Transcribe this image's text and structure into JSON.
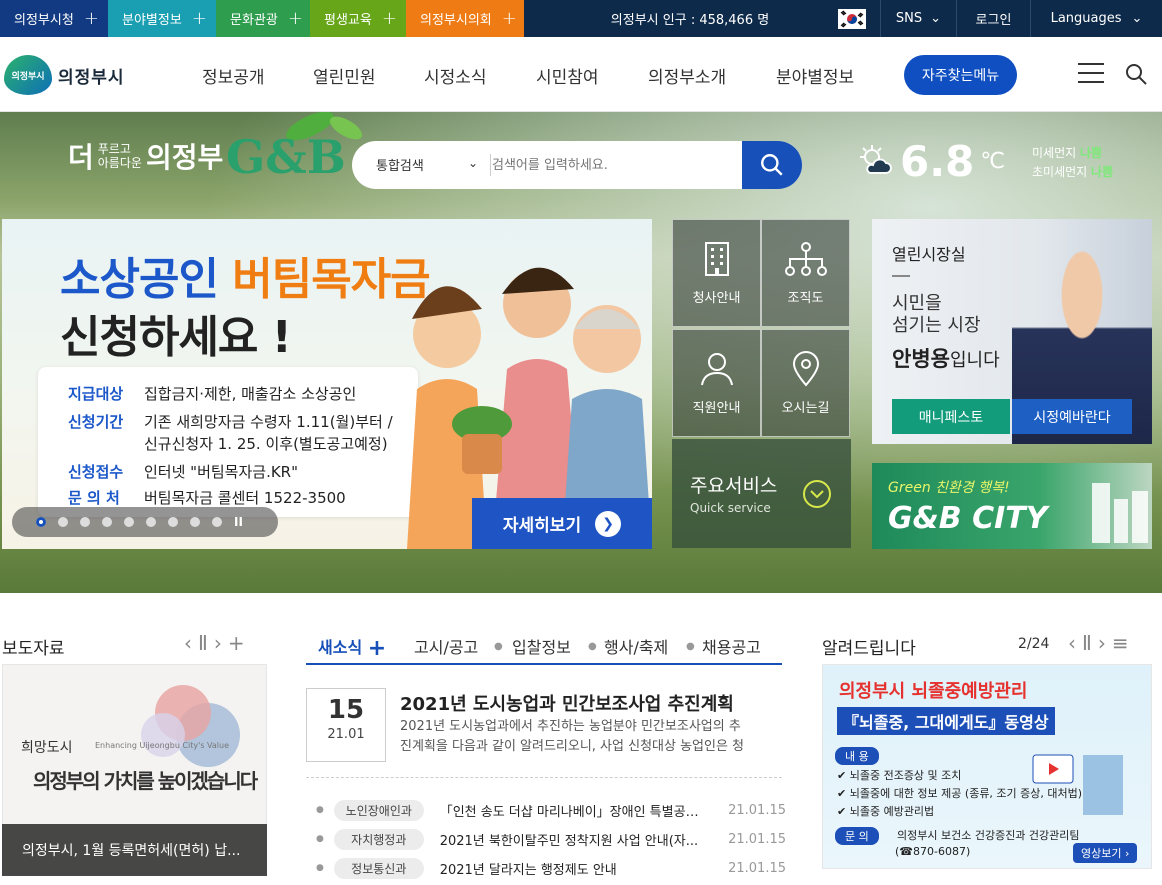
{
  "topbar": {
    "tabs": [
      {
        "label": "의정부시청",
        "color": "#123a82"
      },
      {
        "label": "분야별정보",
        "color": "#1a9fb2"
      },
      {
        "label": "문화관광",
        "color": "#2e9e4e"
      },
      {
        "label": "평생교육",
        "color": "#66a618"
      },
      {
        "label": "의정부시의회",
        "color": "#ef7b14"
      }
    ],
    "population": "의정부시 인구 : 458,466 명",
    "sns": "SNS",
    "login": "로그인",
    "languages": "Languages"
  },
  "header": {
    "logo_mark": "의정부시",
    "logo_text": "의정부시",
    "nav": [
      "정보공개",
      "열린민원",
      "시정소식",
      "시민참여",
      "의정부소개",
      "분야별정보"
    ],
    "quick_menu": "자주찾는메뉴"
  },
  "hero": {
    "slogan_small1": "푸르고",
    "slogan_small2": "아름다운",
    "slogan_big1": "더",
    "slogan_big2": "의정부",
    "gb": "G&B",
    "search": {
      "select": "통합검색",
      "placeholder": "검색어를 입력하세요."
    },
    "weather": {
      "temp": "6.8",
      "unit": "℃",
      "pm10_label": "미세먼지",
      "pm10": "나쁨",
      "pm25_label": "초미세먼지",
      "pm25": "나쁨"
    },
    "banner": {
      "title_blue": "소상공인",
      "title_orange": "버팀목자금",
      "title2": "신청하세요 !",
      "rows": [
        {
          "k": "지급대상",
          "v": "집합금지·제한, 매출감소 소상공인"
        },
        {
          "k": "신청기간",
          "v": "기존 새희망자금 수령자 1.11(월)부터 /"
        },
        {
          "k": "",
          "v": "신규신청자 1. 25. 이후(별도공고예정)"
        },
        {
          "k": "신청접수",
          "v": "인터넷 \"버팀목자금.KR\""
        },
        {
          "k": "문 의 처",
          "v": "버팀목자금 콜센터 1522-3500"
        }
      ],
      "more": "자세히보기",
      "pause": "II"
    },
    "tiles": [
      "청사안내",
      "조직도",
      "직원안내",
      "오시는길"
    ],
    "main_service": {
      "title": "주요서비스",
      "sub": "Quick service"
    },
    "mayor": {
      "title": "열린시장실",
      "line1": "시민을",
      "line2": "섬기는 시장",
      "name": "안병용",
      "suffix": "입니다",
      "btn1": "매니페스토",
      "btn2": "시정예바란다"
    },
    "city": {
      "line1": "Green 친환경 행복!",
      "line2": "G&B CITY"
    }
  },
  "press": {
    "title": "보도자료",
    "photo_text1": "희망도시",
    "photo_text2": "Enhancing Uijeongbu City's Value",
    "photo_text3": "의정부의 가치를 높이겠습니다",
    "caption": "의정부시, 1월 등록면허세(면허) 납..."
  },
  "news": {
    "tabs": [
      "새소식",
      "고시/공고",
      "입찰정보",
      "행사/축제",
      "채용공고"
    ],
    "featured": {
      "day": "15",
      "ym": "21.01",
      "title": "2021년 도시농업과 민간보조사업 추진계획",
      "desc1": "2021년 도시농업과에서 추진하는 농업분야 민간보조사업의 추",
      "desc2": "진계획을 다음과 같이 알려드리오니, 사업 신청대상 농업인은 청"
    },
    "items": [
      {
        "dept": "노인장애인과",
        "title": "「인천 송도 더샵 마리나베이」장애인 특별공급 ...",
        "date": "21.01.15"
      },
      {
        "dept": "자치행정과",
        "title": "2021년 북한이탈주민 정착지원 사업 안내(자...",
        "date": "21.01.15"
      },
      {
        "dept": "정보통신과",
        "title": "2021년 달라지는 행정제도 안내",
        "date": "21.01.15"
      }
    ]
  },
  "notice": {
    "title": "알려드립니다",
    "page": "2/24",
    "banner": {
      "h1": "의정부시 뇌졸중예방관리",
      "h2": "『뇌졸중, 그대에게도』동영상",
      "content_label": "내 용",
      "items": [
        "뇌졸중 전조증상 및 조치",
        "뇌졸중에 대한 정보 제공 (종류, 조기 증상, 대처법)",
        "뇌졸중 예방관리법"
      ],
      "inquiry_label": "문 의",
      "inquiry": "의정부시 보건소 건강증진과 건강관리팀",
      "phone": "(☎870-6087)",
      "video_btn": "영상보기 ›"
    }
  }
}
